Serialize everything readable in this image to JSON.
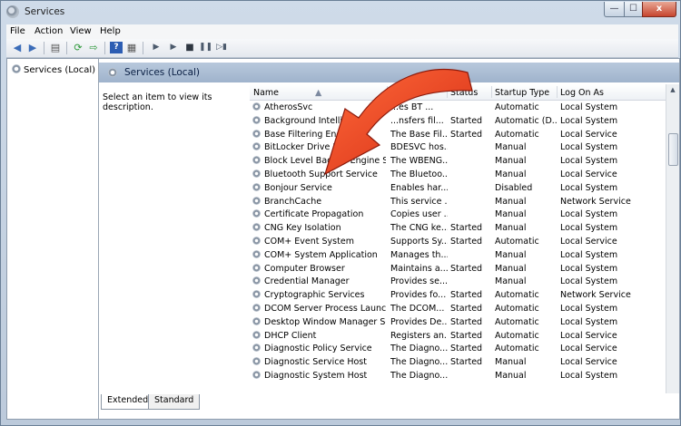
{
  "window": {
    "title": "Services"
  },
  "window_controls": {
    "minimize": "—",
    "maximize": "☐",
    "close": "x"
  },
  "menu": [
    "File",
    "Action",
    "View",
    "Help"
  ],
  "tree": {
    "root_label": "Services (Local)"
  },
  "pane": {
    "title": "Services (Local)",
    "description_prompt": "Select an item to view its description."
  },
  "columns": {
    "name": "Name",
    "description": "Description",
    "status": "Status",
    "startup_type": "Startup Type",
    "log_on_as": "Log On As"
  },
  "rows": [
    {
      "name": "AtherosSvc",
      "description": "...es BT ...",
      "status": "",
      "startup": "Automatic",
      "logon": "Local System"
    },
    {
      "name": "Background Intellig...",
      "description": "...nsfers fil...",
      "status": "Started",
      "startup": "Automatic (D...",
      "logon": "Local System"
    },
    {
      "name": "Base Filtering Engin...",
      "description": "The Base Fil...",
      "status": "Started",
      "startup": "Automatic",
      "logon": "Local Service"
    },
    {
      "name": "BitLocker Drive Encr...",
      "description": "BDESVC hos...",
      "status": "",
      "startup": "Manual",
      "logon": "Local System"
    },
    {
      "name": "Block Level Backup Engine Ser...",
      "description": "The WBENG...",
      "status": "",
      "startup": "Manual",
      "logon": "Local System"
    },
    {
      "name": "Bluetooth Support Service",
      "description": "The Bluetoo...",
      "status": "",
      "startup": "Manual",
      "logon": "Local Service"
    },
    {
      "name": "Bonjour Service",
      "description": "Enables har...",
      "status": "",
      "startup": "Disabled",
      "logon": "Local System"
    },
    {
      "name": "BranchCache",
      "description": "This service ...",
      "status": "",
      "startup": "Manual",
      "logon": "Network Service"
    },
    {
      "name": "Certificate Propagation",
      "description": "Copies user ...",
      "status": "",
      "startup": "Manual",
      "logon": "Local System"
    },
    {
      "name": "CNG Key Isolation",
      "description": "The CNG ke...",
      "status": "Started",
      "startup": "Manual",
      "logon": "Local System"
    },
    {
      "name": "COM+ Event System",
      "description": "Supports Sy...",
      "status": "Started",
      "startup": "Automatic",
      "logon": "Local Service"
    },
    {
      "name": "COM+ System Application",
      "description": "Manages th...",
      "status": "",
      "startup": "Manual",
      "logon": "Local System"
    },
    {
      "name": "Computer Browser",
      "description": "Maintains a...",
      "status": "Started",
      "startup": "Manual",
      "logon": "Local System"
    },
    {
      "name": "Credential Manager",
      "description": "Provides se...",
      "status": "",
      "startup": "Manual",
      "logon": "Local System"
    },
    {
      "name": "Cryptographic Services",
      "description": "Provides fo...",
      "status": "Started",
      "startup": "Automatic",
      "logon": "Network Service"
    },
    {
      "name": "DCOM Server Process Launcher",
      "description": "The DCOM...",
      "status": "Started",
      "startup": "Automatic",
      "logon": "Local System"
    },
    {
      "name": "Desktop Window Manager Ses...",
      "description": "Provides De...",
      "status": "Started",
      "startup": "Automatic",
      "logon": "Local System"
    },
    {
      "name": "DHCP Client",
      "description": "Registers an...",
      "status": "Started",
      "startup": "Automatic",
      "logon": "Local Service"
    },
    {
      "name": "Diagnostic Policy Service",
      "description": "The Diagno...",
      "status": "Started",
      "startup": "Automatic",
      "logon": "Local Service"
    },
    {
      "name": "Diagnostic Service Host",
      "description": "The Diagno...",
      "status": "Started",
      "startup": "Manual",
      "logon": "Local Service"
    },
    {
      "name": "Diagnostic System Host",
      "description": "The Diagno...",
      "status": "",
      "startup": "Manual",
      "logon": "Local System"
    }
  ],
  "tabs": [
    "Extended",
    "Standard"
  ],
  "toolbar_icons": [
    "back-icon",
    "forward-icon",
    "show-hide-tree-icon",
    "refresh-icon",
    "export-list-icon",
    "help-icon",
    "properties-icon",
    "play-icon",
    "play-paused-icon",
    "stop-icon",
    "pause-icon",
    "restart-icon"
  ],
  "colors": {
    "annotation_arrow": "#e8391e",
    "header_band": "#a9bcd3"
  }
}
